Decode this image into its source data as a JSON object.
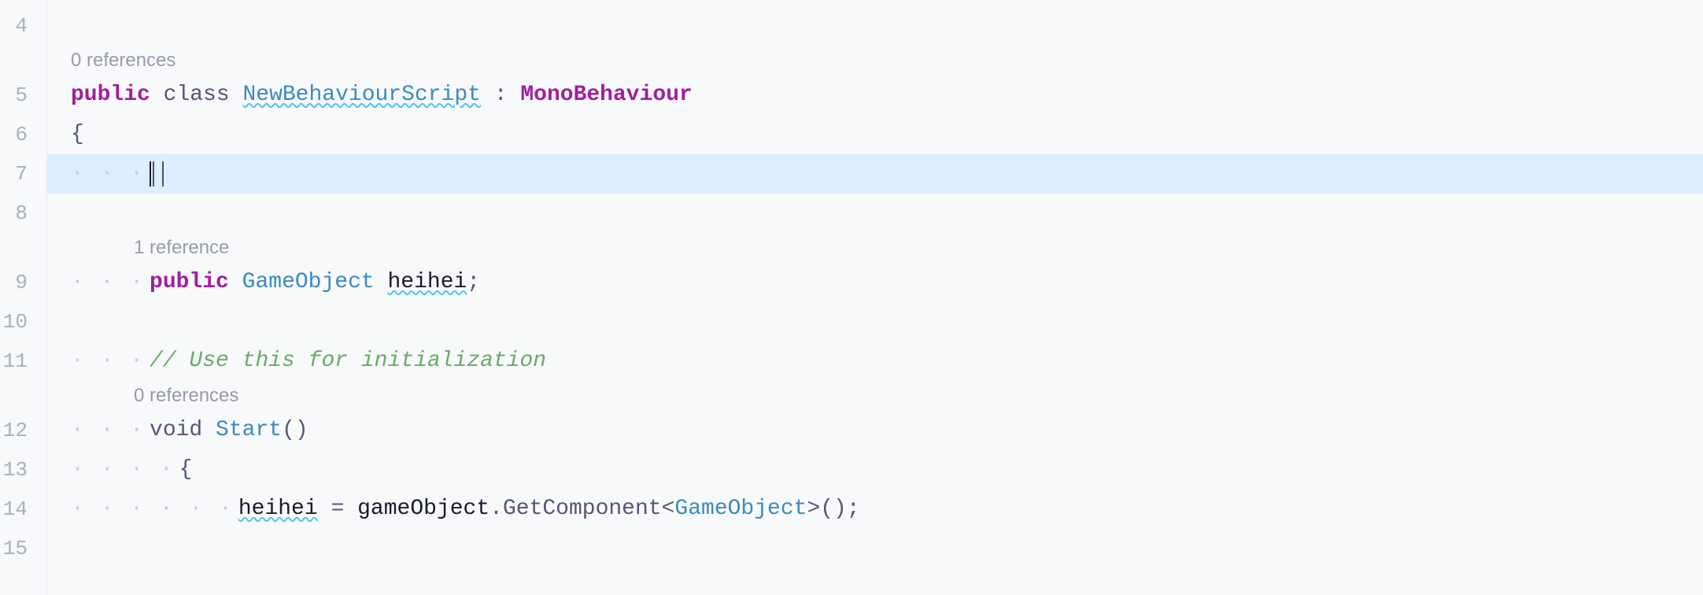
{
  "editor": {
    "background": "#f8f9fb",
    "active_line_bg": "#dceeff"
  },
  "lines": [
    {
      "number": "4",
      "type": "empty",
      "content": ""
    },
    {
      "number": "5",
      "type": "class-decl",
      "hint": null,
      "content": "public class NewBehaviourScript : MonoBehaviour"
    },
    {
      "number": "6",
      "type": "brace-open",
      "content": "{"
    },
    {
      "number": "7",
      "type": "active-cursor",
      "content": ""
    },
    {
      "number": "8",
      "type": "empty",
      "content": ""
    },
    {
      "number": "9",
      "type": "field-decl",
      "hint": "1 reference",
      "content": "public GameObject heihei;"
    },
    {
      "number": "10",
      "type": "empty",
      "content": ""
    },
    {
      "number": "11",
      "type": "comment",
      "content": "// Use this for initialization"
    },
    {
      "number": "12",
      "type": "method-decl",
      "hint": "0 references",
      "content": "void Start()"
    },
    {
      "number": "13",
      "type": "brace-open-indent",
      "content": "{"
    },
    {
      "number": "14",
      "type": "assignment",
      "content": "heihei = gameObject.GetComponent<GameObject>();"
    },
    {
      "number": "15",
      "type": "empty",
      "content": ""
    }
  ],
  "hints": {
    "references_0": "0 references",
    "references_1": "1 reference",
    "comment_text": "// Use this for initialization"
  },
  "tokens": {
    "public": "public",
    "class": "class",
    "NewBehaviourScript": "NewBehaviourScript",
    "colon": ":",
    "MonoBehaviour": "MonoBehaviour",
    "brace_open": "{",
    "void": "void",
    "Start": "Start",
    "parens": "()",
    "heihei": "heihei",
    "equals": "=",
    "gameObject": "gameObject",
    "dot": ".",
    "GetComponent": "GetComponent",
    "angle_open": "<",
    "GameObject": "GameObject",
    "angle_close": ">",
    "semicolon": ";"
  }
}
